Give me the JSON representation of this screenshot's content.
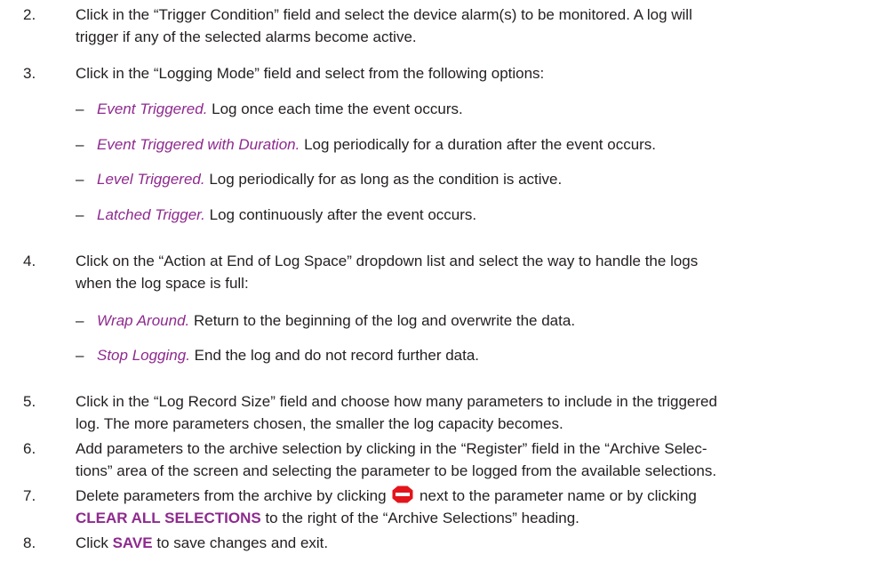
{
  "steps": {
    "s2": {
      "num": "2.",
      "line1": "Click in the “Trigger Condition” field and select the device alarm(s) to be monitored. A log will",
      "line2": "trigger if any of the selected alarms become active."
    },
    "s3": {
      "num": "3.",
      "text": "Click in the “Logging Mode” field and select from the following options:"
    },
    "s4": {
      "num": "4.",
      "line1": "Click on the “Action at End of Log Space” dropdown list and select the way to handle the logs",
      "line2": "when the log space is full:"
    },
    "s5": {
      "num": "5.",
      "line1": "Click in the “Log Record Size” field and choose how many parameters to include in the triggered",
      "line2": "log. The more parameters chosen, the smaller the log capacity becomes."
    },
    "s6": {
      "num": "6.",
      "line1": "Add parameters to the archive selection by clicking in the “Register” field in the “Archive Selec-",
      "line2": "tions” area of the screen and selecting the parameter to be logged from the available selections."
    },
    "s7": {
      "num": "7.",
      "line1_before": "Delete parameters from the archive by clicking ",
      "line1_after": " next to the parameter name or by clicking",
      "line2_keyword": "CLEAR ALL SELECTIONS",
      "line2_after": " to the right of the “Archive Selections” heading."
    },
    "s8": {
      "num": "8.",
      "before": "Click ",
      "keyword": "SAVE",
      "after": " to save changes and exit."
    }
  },
  "logging_modes": [
    {
      "dash": "–",
      "term": "Event Triggered.",
      "desc": " Log once each time the event occurs."
    },
    {
      "dash": "–",
      "term": "Event Triggered with Duration.",
      "desc": " Log periodically for a duration after the event occurs."
    },
    {
      "dash": "–",
      "term": "Level Triggered.",
      "desc": " Log periodically for as long as the condition is active."
    },
    {
      "dash": "–",
      "term": "Latched Trigger.",
      "desc": " Log continuously after the event occurs."
    }
  ],
  "end_actions": [
    {
      "dash": "–",
      "term": "Wrap Around.",
      "desc": " Return to the beginning of the log and overwrite the data."
    },
    {
      "dash": "–",
      "term": "Stop Logging.",
      "desc": " End the log and do not record further data."
    }
  ],
  "icons": {
    "delete_icon": "stop-sign-icon",
    "delete_color": "#e3151b",
    "accent_color": "#8e2a8e"
  }
}
